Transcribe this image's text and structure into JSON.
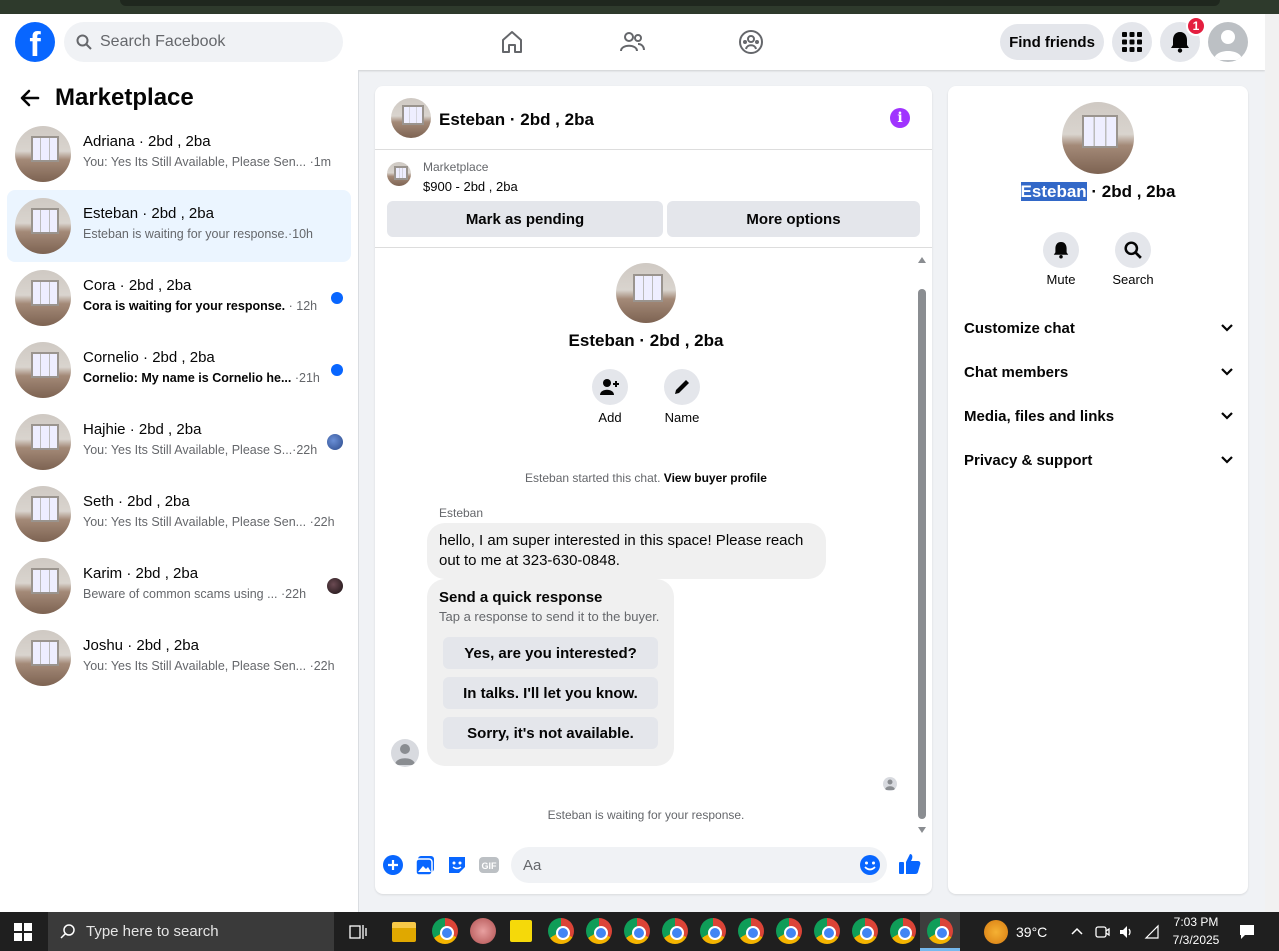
{
  "header": {
    "search_placeholder": "Search Facebook",
    "find_friends": "Find friends",
    "notifications_count": "1",
    "logo_letter": "f"
  },
  "sidebar": {
    "title": "Marketplace",
    "conversations": [
      {
        "title": "Adriana · 2bd , 2ba",
        "snippet": "You: Yes Its Still Available, Please Sen...",
        "time": "·1m",
        "unread": false
      },
      {
        "title": "Esteban · 2bd , 2ba",
        "snippet": "Esteban is waiting for your response.",
        "time": "·10h",
        "unread": false,
        "active": true
      },
      {
        "title": "Cora · 2bd , 2ba",
        "snippet": "Cora is waiting for your response.",
        "time": "· 12h",
        "unread": true
      },
      {
        "title": "Cornelio · 2bd , 2ba",
        "snippet": "Cornelio: My name is Cornelio he...",
        "time": "·21h",
        "unread": true
      },
      {
        "title": "Hajhie · 2bd , 2ba",
        "snippet": "You: Yes Its Still Available, Please S...",
        "time": "·22h",
        "unread": false
      },
      {
        "title": "Seth · 2bd , 2ba",
        "snippet": "You: Yes Its Still Available, Please Sen...",
        "time": "·22h",
        "unread": false
      },
      {
        "title": "Karim · 2bd , 2ba",
        "snippet": "Beware of common scams using ...",
        "time": "·22h",
        "unread": false
      },
      {
        "title": "Joshu · 2bd , 2ba",
        "snippet": "You: Yes Its Still Available, Please Sen...",
        "time": "·22h",
        "unread": false
      }
    ]
  },
  "chat": {
    "header_name": "Esteban · 2bd , 2ba",
    "listing_source": "Marketplace",
    "listing_detail": "$900 - 2bd , 2ba",
    "mark_pending": "Mark as pending",
    "more_options": "More options",
    "profile_name": "Esteban · 2bd , 2ba",
    "add_label": "Add",
    "name_label": "Name",
    "started_text": "Esteban started this chat.",
    "view_profile": "View buyer profile",
    "sender": "Esteban",
    "message": "hello, I am super interested in this space! Please reach out to me at 323-630-0848.",
    "quick_title": "Send a quick response",
    "quick_sub": "Tap a response to send it to the buyer.",
    "quick_options": [
      "Yes, are you interested?",
      "In talks. I'll let you know.",
      "Sorry, it's not available."
    ],
    "waiting": "Esteban is waiting for your response.",
    "input_placeholder": "Aa"
  },
  "details": {
    "name_highlight": "Esteban",
    "name_rest": " · 2bd , 2ba",
    "mute": "Mute",
    "search": "Search",
    "sections": [
      "Customize chat",
      "Chat members",
      "Media, files and links",
      "Privacy & support"
    ]
  },
  "taskbar": {
    "search_placeholder": "Type here to search",
    "temperature": "39°C",
    "time": "7:03 PM",
    "date": "7/3/2025"
  },
  "colors": {
    "brand": "#0866ff",
    "unread_dot": "#0866ff",
    "info_purple": "#a033ff",
    "badge_red": "#e41e3f"
  }
}
